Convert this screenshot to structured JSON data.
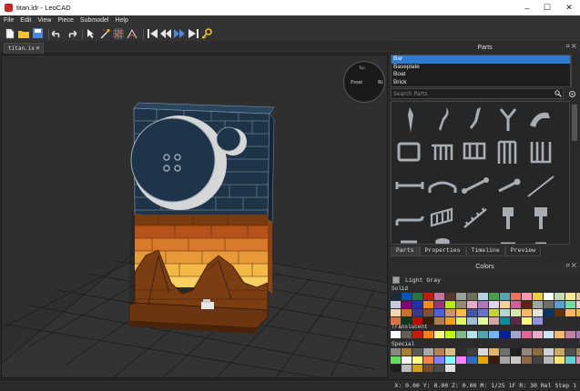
{
  "window": {
    "title": "titan.ldr - LeoCAD",
    "minimize": "–",
    "maximize": "☐",
    "close": "✕"
  },
  "menu": [
    "File",
    "Edit",
    "View",
    "Piece",
    "Submodel",
    "Help"
  ],
  "toolbar": {
    "icons": [
      "new-file-icon",
      "open-folder-icon",
      "save-icon",
      "undo-icon",
      "redo-icon",
      "select-arrow-icon",
      "magic-wand-icon",
      "grid-snap-icon",
      "angle-snap-icon",
      "first-step-icon",
      "previous-step-icon",
      "next-step-icon",
      "last-step-icon",
      "key-icon"
    ],
    "colors": {
      "red": "#d84a3a",
      "blue": "#4a89dc",
      "yellow": "#f1c232",
      "white": "#e8e8e8"
    }
  },
  "document_tab": {
    "label": "titan.ix",
    "close": "✕"
  },
  "viewcube": {
    "front": "Front",
    "right": "Ri",
    "top": "Top"
  },
  "parts_panel": {
    "title": "Parts",
    "panel_controls": "⌗ ✕",
    "categories": [
      {
        "label": "Bar",
        "selected": true
      },
      {
        "label": "Baseplate",
        "selected": false
      },
      {
        "label": "Boat",
        "selected": false
      },
      {
        "label": "Brick",
        "selected": false
      }
    ],
    "search_placeholder": "Search Parts",
    "search_icon": "🔍",
    "tabs": [
      "Parts",
      "Properties",
      "Timeline",
      "Preview"
    ],
    "active_tab": "Parts"
  },
  "colors_panel": {
    "title": "Colors",
    "panel_controls": "⌗ ✕",
    "current_color": "Light Gray",
    "current_color_hex": "#9ba19d",
    "sections": [
      {
        "name": "Solid",
        "swatches": [
          "#1b2a34",
          "#0055bf",
          "#237841",
          "#c91a09",
          "#c870a0",
          "#583927",
          "#9ba19d",
          "#6d6e5c",
          "#b4d2e3",
          "#4b9f4a",
          "#55a5af",
          "#f2705e",
          "#fc97ac",
          "#f2cd37",
          "#ffffff",
          "#c2dab8",
          "#fbe696",
          "#e4cd9e",
          "#c9cae2",
          "#81007b",
          "#2032b0",
          "#fe8a18",
          "#923978",
          "#bbe90b",
          "#958a73",
          "#e4adc8",
          "#ac78ba",
          "#e1d5ed",
          "#f3cf9b",
          "#cd6298",
          "#582a12",
          "#a0a5a9",
          "#6c6e68",
          "#5c9dd1",
          "#73dca1",
          "#fecccf",
          "#f6d7b3",
          "#cc702a",
          "#3f3691",
          "#7c503a",
          "#4c61db",
          "#d09168",
          "#feba48",
          "#4354a3",
          "#6874ca",
          "#c7d23c",
          "#b3d7d1",
          "#d9e4a7",
          "#f9ba61",
          "#e6e3da",
          "#0a3463",
          "#5f3109",
          "#fcb76d",
          "#f8bb3d",
          "#d67240",
          "#063c1b",
          "#b31004",
          "#352100",
          "#aa7d55",
          "#fa9c1c",
          "#dff669",
          "#9fbbd9",
          "#e2f99a",
          "#d6a5a8",
          "#008f9b",
          "#5b2b49",
          "#fefa80",
          "#9391e4"
        ]
      },
      {
        "name": "Translucent",
        "swatches": [
          "#fcfcfc",
          "#635f52",
          "#c91a09",
          "#ff800d",
          "#f8f184",
          "#c0ff00",
          "#84b68d",
          "#b6e0ea",
          "#55a5af",
          "#6bb7ff",
          "#0020a0",
          "#a5a5cb",
          "#df6695",
          "#e4adc8",
          "#cee3f6",
          "#fcb76d",
          "#c281a5",
          "#ac78ba"
        ]
      },
      {
        "name": "Special",
        "swatches": [
          "#898788",
          "#aa7f2e",
          "#5a5a5a",
          "#a8a9ab",
          "#b48455",
          "#dcbc81",
          "#2e2e2e",
          "#3f3f3f",
          "#d9d9d9",
          "#e6b36b",
          "#707070",
          "#1e1e1e",
          "#93867b",
          "#8b6b3c",
          "#cfd2d4",
          "#c9ac61",
          "#505050",
          "#a0855b",
          "#64dc64",
          "#f5f5f5",
          "#ffff80",
          "#ff8040",
          "#8080ff",
          "#80ffff",
          "#ff80ff",
          "#2b6dc4",
          "#e2a800",
          "#3a1d0a",
          "#a3a2a4",
          "#c8c8c8",
          "#8f6a46",
          "#444444",
          "#b7b7b7",
          "#ffe371",
          "#62d0d0",
          "#f785b1",
          "#1c1c1c",
          "#bbbbbb",
          "#d4a017",
          "#7a4b2a",
          "#4a4a4a",
          "#e0e0e0"
        ]
      }
    ]
  },
  "status": "X: 0.00 Y: 0.00 Z: 0.00  M: 1/25 1F R: 30 Rel  Step 1"
}
